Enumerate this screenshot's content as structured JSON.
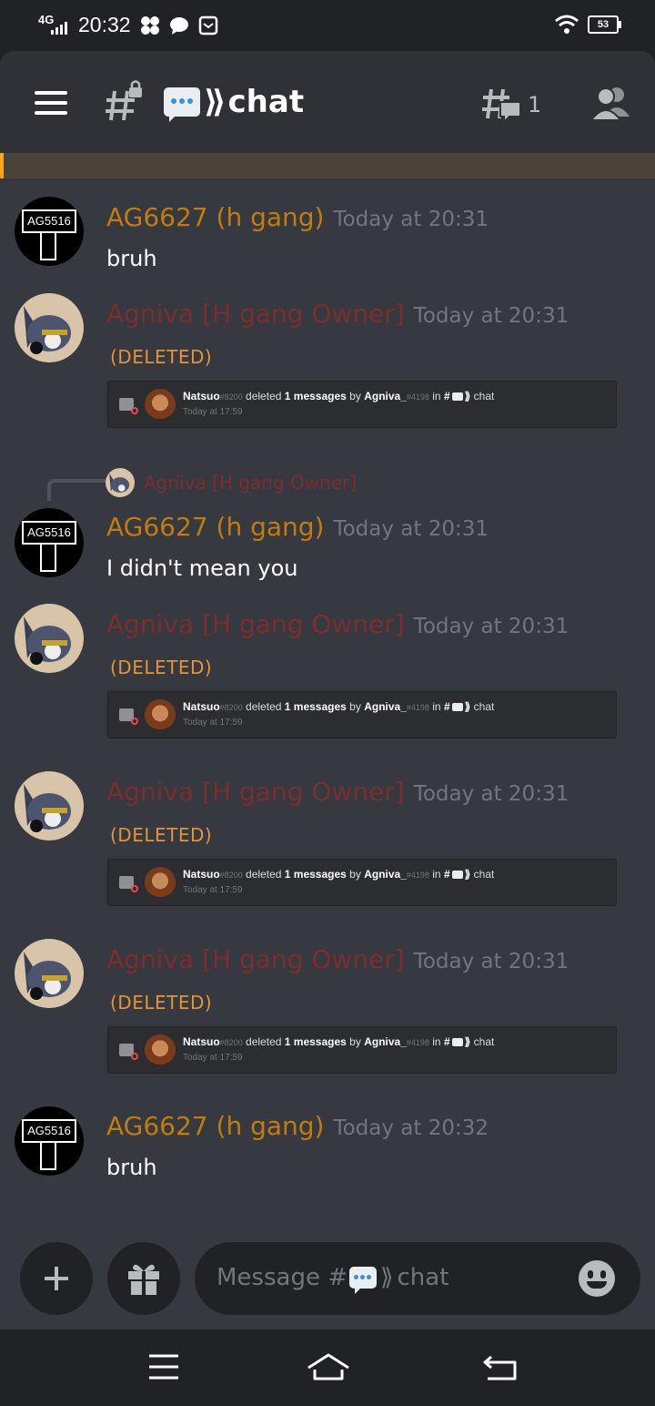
{
  "status_bar": {
    "network": "4G",
    "time": "20:32",
    "battery": "53"
  },
  "header": {
    "channel_name": "chat",
    "threads_count": "1"
  },
  "messages": [
    {
      "author": "AG6627 (h gang)",
      "timestamp": "Today at 20:31",
      "text": "bruh",
      "avatar_text": "AG5516"
    },
    {
      "author": "Agniva [H gang Owner]",
      "timestamp": "Today at 20:31",
      "text": "(DELETED)"
    },
    {
      "author": "AG6627 (h gang)",
      "timestamp": "Today at 20:31",
      "text": "I didn't mean you",
      "avatar_text": "AG5516",
      "reply_to": "Agniva [H gang Owner]"
    },
    {
      "author": "Agniva [H gang Owner]",
      "timestamp": "Today at 20:31",
      "text": "(DELETED)"
    },
    {
      "author": "Agniva [H gang Owner]",
      "timestamp": "Today at 20:31",
      "text": "(DELETED)"
    },
    {
      "author": "Agniva [H gang Owner]",
      "timestamp": "Today at 20:31",
      "text": "(DELETED)"
    },
    {
      "author": "AG6627 (h gang)",
      "timestamp": "Today at 20:32",
      "text": "bruh",
      "avatar_text": "AG5516"
    }
  ],
  "log_embed": {
    "moderator": "Natsuo",
    "moderator_tag": "#8200",
    "action": "deleted",
    "count": "1 messages",
    "by_word": "by",
    "target": "Agniva_",
    "target_tag": "#4198",
    "in_word": "in",
    "channel": "chat",
    "time": "Today at 17:59"
  },
  "composer": {
    "placeholder_prefix": "Message #",
    "placeholder_channel": "chat"
  },
  "colors": {
    "background": "#36393f",
    "header": "#2f3136",
    "ag_name": "#c27c0e",
    "agniva_name": "#7a2e2e",
    "deleted_text": "#e49432"
  }
}
